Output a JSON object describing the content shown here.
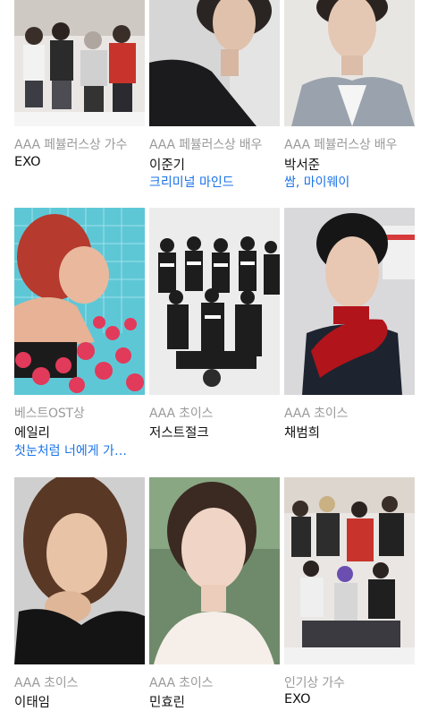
{
  "cards": [
    {
      "category": "AAA 페뷸러스상 가수",
      "name": "EXO",
      "work": "",
      "photo_desc": "group-photo-icon",
      "bg": "#e9e6e4"
    },
    {
      "category": "AAA 페뷸러스상 배우",
      "name": "이준기",
      "work": "크리미널 마인드",
      "photo_desc": "portrait-icon",
      "bg": "#d6d6d6"
    },
    {
      "category": "AAA 페뷸러스상 배우",
      "name": "박서준",
      "work": "쌈, 마이웨이",
      "photo_desc": "portrait-icon",
      "bg": "#e8e6e3"
    },
    {
      "category": "베스트OST상",
      "name": "에일리",
      "work": "첫눈처럼 너에게 가…",
      "photo_desc": "portrait-icon",
      "bg": "#5ec7d6"
    },
    {
      "category": "AAA 초이스",
      "name": "저스트절크",
      "work": "",
      "photo_desc": "group-photo-icon",
      "bg": "#ececec"
    },
    {
      "category": "AAA 초이스",
      "name": "채범희",
      "work": "",
      "photo_desc": "portrait-icon",
      "bg": "#d9d9dc"
    },
    {
      "category": "AAA 초이스",
      "name": "이태임",
      "work": "",
      "photo_desc": "portrait-icon",
      "bg": "#cfcfcf"
    },
    {
      "category": "AAA 초이스",
      "name": "민효린",
      "work": "",
      "photo_desc": "portrait-icon",
      "bg": "#6f8a6a"
    },
    {
      "category": "인기상 가수",
      "name": "EXO",
      "work": "",
      "photo_desc": "group-photo-icon",
      "bg": "#e9e6e4"
    }
  ]
}
